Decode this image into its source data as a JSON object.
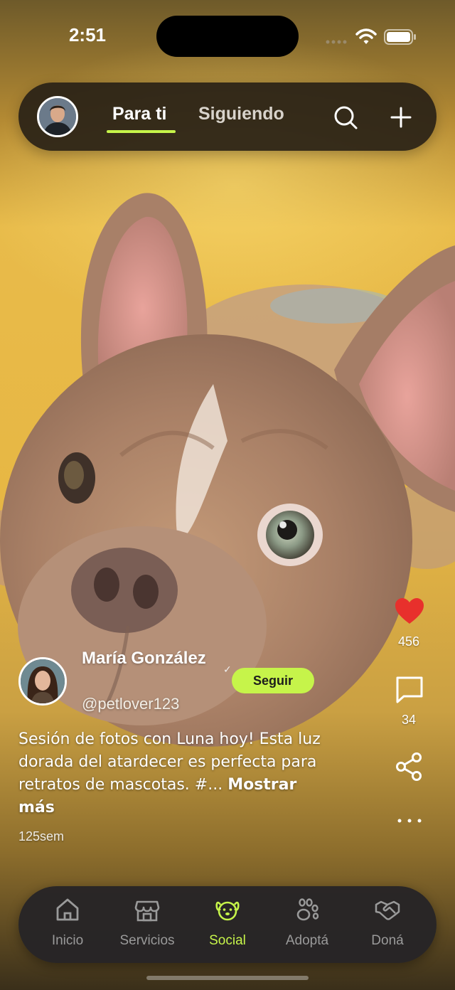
{
  "status_bar": {
    "time": "2:51"
  },
  "top_bar": {
    "tabs": [
      {
        "label": "Para ti",
        "active": true
      },
      {
        "label": "Siguiendo",
        "active": false
      }
    ],
    "search_icon": "search-icon",
    "add_icon": "plus-icon"
  },
  "post": {
    "author": {
      "name": "María González",
      "handle": "@petlover123"
    },
    "follow_label": "Seguir",
    "caption": "Sesión de fotos con Luna hoy! Esta luz dorada del atardecer es perfecta para retratos de mascotas. #...",
    "show_more_label": "Mostrar más",
    "age": "125sem",
    "likes": "456",
    "comments": "34"
  },
  "bottom_nav": {
    "items": [
      {
        "label": "Inicio",
        "icon": "home-icon"
      },
      {
        "label": "Servicios",
        "icon": "store-icon"
      },
      {
        "label": "Social",
        "icon": "dog-face-icon",
        "active": true
      },
      {
        "label": "Adoptá",
        "icon": "paw-icon"
      },
      {
        "label": "Doná",
        "icon": "handshake-icon"
      }
    ]
  },
  "colors": {
    "accent": "#c6f44a",
    "like": "#e8302c",
    "bar_background": "#282116",
    "nav_background": "#262426",
    "photo_background": "#e7b744"
  }
}
